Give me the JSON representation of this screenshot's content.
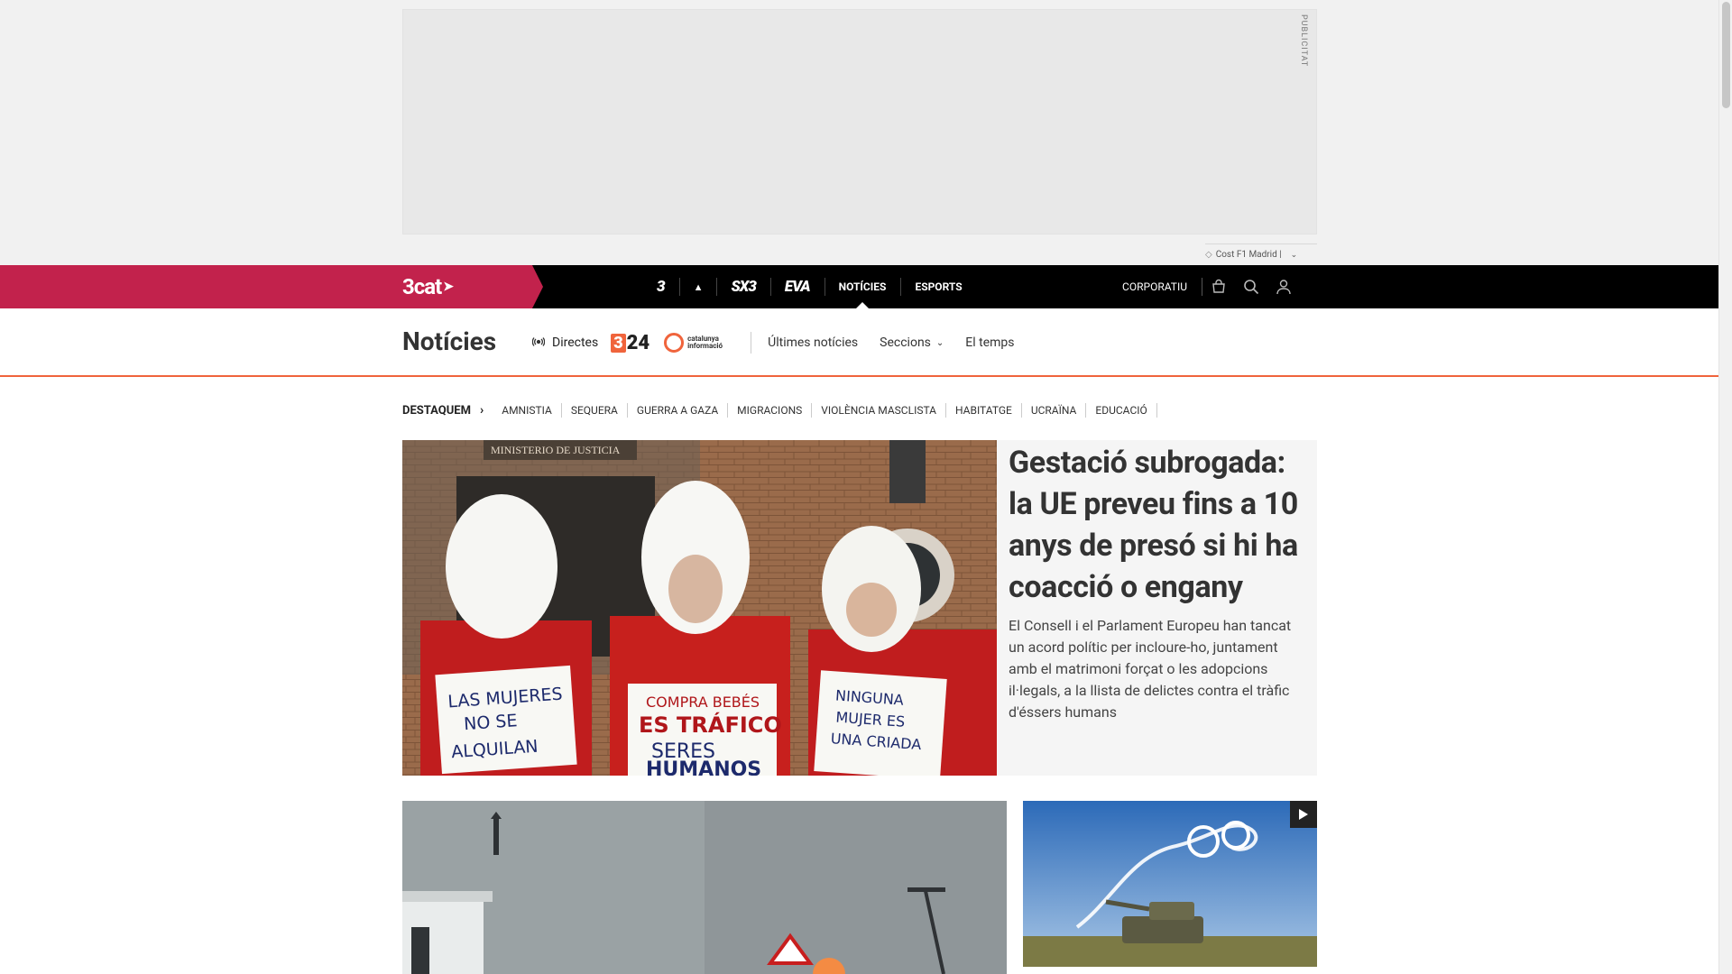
{
  "ad": {
    "label": "PUBLICITAT",
    "sponsor": "Cost F1 Madrid |"
  },
  "topbar": {
    "brand": "3cat",
    "channels": [
      {
        "label": "3",
        "name": "tv3"
      },
      {
        "label": "Cat Ràdio",
        "name": "catradio"
      },
      {
        "label": "SX3",
        "name": "sx3"
      },
      {
        "label": "EVA",
        "name": "eva"
      },
      {
        "label": "NOTÍCIES",
        "name": "noticies"
      },
      {
        "label": "ESPORTS",
        "name": "esports"
      }
    ],
    "corporate": "CORPORATIU",
    "accent": "#c2224c"
  },
  "section": {
    "title": "Notícies",
    "directes": "Directes",
    "logo_324": "24",
    "logo_ci": "catalunya informació",
    "links": [
      "Últimes notícies",
      "Seccions",
      "El temps"
    ],
    "accent": "#f0643c"
  },
  "destaquem": {
    "label": "DESTAQUEM",
    "topics": [
      "AMNISTIA",
      "SEQUERA",
      "GUERRA A GAZA",
      "MIGRACIONS",
      "VIOLÈNCIA MASCLISTA",
      "HABITATGE",
      "UCRAÏNA",
      "EDUCACIÓ"
    ]
  },
  "hero": {
    "title": "Gestació subrogada: la UE preveu fins a 10 anys de presó si hi ha coacció o engany",
    "subtitle": "El Consell i el Parlament Europeu han tancat un acord polític per incloure-ho, juntament amb el matrimoni forçat o les adopcions il·legals, a la llista de delictes contra el tràfic d'éssers humans",
    "image_signs": [
      "MINISTERIO DE JUSTICIA",
      "LAS MUJERES NO SE ALQUILAN",
      "COMPRA BEBÉS ES TRÁFICO DE SERES HUMANOS",
      "NINGUNA MUJER ES UNA CRIADA"
    ]
  }
}
